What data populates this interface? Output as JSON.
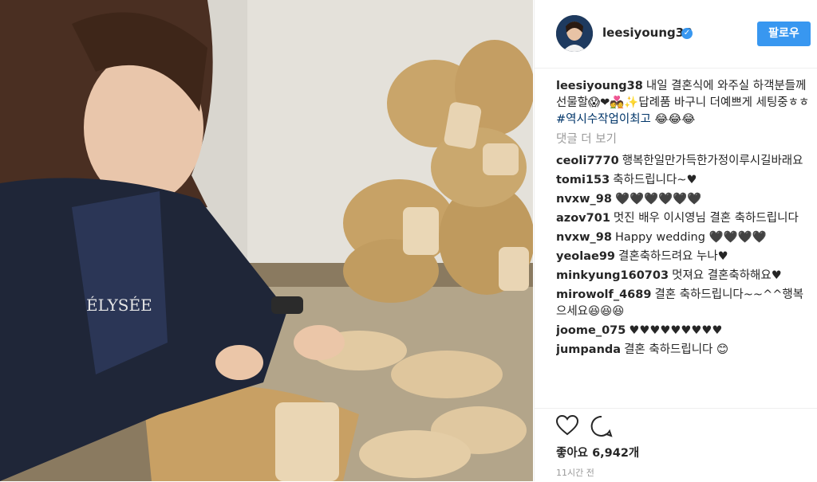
{
  "post": {
    "username": "leesiyoung38",
    "follow_label": "팔로우",
    "caption_user": "leesiyoung38",
    "caption_text": "내일 결혼식에 와주실 하객분들께 선물할😱❤💑✨답례품 바구니 더예쁘게 세팅중ㅎㅎ",
    "caption_tag": "#역시수작업이최고",
    "caption_end": " 😂😂😂",
    "more_comments": "댓글 더 보기",
    "likes": "좋아요 6,942개",
    "time": "11시간 전"
  },
  "comments": [
    {
      "user": "ceoli7770",
      "text": "행복한일만가득한가정이루시길바래요"
    },
    {
      "user": "tomi153",
      "text": "축하드립니다~♥"
    },
    {
      "user": "nvxw_98",
      "text": "🖤🖤🖤🖤🖤🖤"
    },
    {
      "user": "azov701",
      "text": "멋진 배우 이시영님 결혼 축하드립니다"
    },
    {
      "user": "nvxw_98",
      "text": "Happy wedding 🖤🖤🖤🖤"
    },
    {
      "user": "yeolae99",
      "text": "결혼축하드려요 누나♥"
    },
    {
      "user": "minkyung160703",
      "text": "멋져요 결혼축하해요♥"
    },
    {
      "user": "mirowolf_4689",
      "text": "결혼 축하드립니다~~^^행복으세요😆😆😆"
    },
    {
      "user": "joome_075",
      "text": "♥♥♥♥♥♥♥♥♥"
    },
    {
      "user": "jumpanda",
      "text": "결혼 축하드립니다 😊"
    }
  ],
  "icons": {
    "like": "heart-icon",
    "comment": "comment-icon",
    "verified": "verified-badge-icon"
  },
  "colors": {
    "accent": "#3897f0",
    "text": "#262626",
    "muted": "#999999"
  }
}
